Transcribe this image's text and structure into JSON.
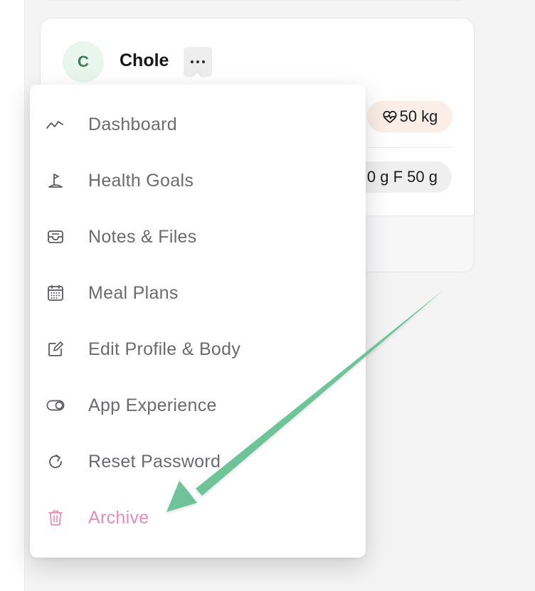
{
  "card": {
    "avatar_initial": "C",
    "name": "Chole",
    "weight": "50 kg",
    "macros": "0 g  F 50 g"
  },
  "menu": {
    "items": [
      {
        "label": "Dashboard",
        "icon": "trend-line-icon"
      },
      {
        "label": "Health Goals",
        "icon": "flag-icon"
      },
      {
        "label": "Notes & Files",
        "icon": "inbox-tray-icon"
      },
      {
        "label": "Meal Plans",
        "icon": "calendar-icon"
      },
      {
        "label": "Edit Profile & Body",
        "icon": "edit-square-icon"
      },
      {
        "label": "App Experience",
        "icon": "toggle-icon"
      },
      {
        "label": "Reset Password",
        "icon": "refresh-icon"
      },
      {
        "label": "Archive",
        "icon": "trash-icon",
        "danger": true
      }
    ]
  },
  "colors": {
    "danger": "#e58db3",
    "avatar_bg": "#e9f6ee",
    "avatar_text": "#3f7b59",
    "weight_pill_bg": "#faeee6",
    "annotation_arrow": "#6ec498"
  }
}
